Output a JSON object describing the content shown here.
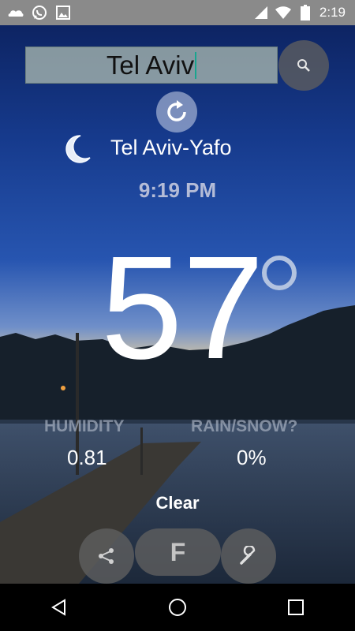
{
  "status_bar": {
    "time": "2:19",
    "left_icons": [
      "cloud-icon",
      "whatsapp-icon",
      "image-icon"
    ],
    "right_icons": [
      "signal-icon",
      "wifi-icon",
      "battery-icon"
    ]
  },
  "search": {
    "value": "Tel Aviv"
  },
  "weather": {
    "icon": "moon-icon",
    "city": "Tel Aviv-Yafo",
    "local_time": "9:19 PM",
    "temperature": "57",
    "humidity_label": "HUMIDITY",
    "humidity_value": "0.81",
    "rain_label": "RAIN/SNOW?",
    "rain_value": "0%",
    "condition": "Clear"
  },
  "controls": {
    "unit": "F",
    "share_icon": "share-icon",
    "settings_icon": "wrench-icon"
  },
  "nav": {
    "buttons": [
      "back-icon",
      "home-icon",
      "recents-icon"
    ]
  },
  "colors": {
    "status_bar": "#8a8a8a",
    "caret": "#19a58f",
    "time_text": "#b4bcd7"
  }
}
